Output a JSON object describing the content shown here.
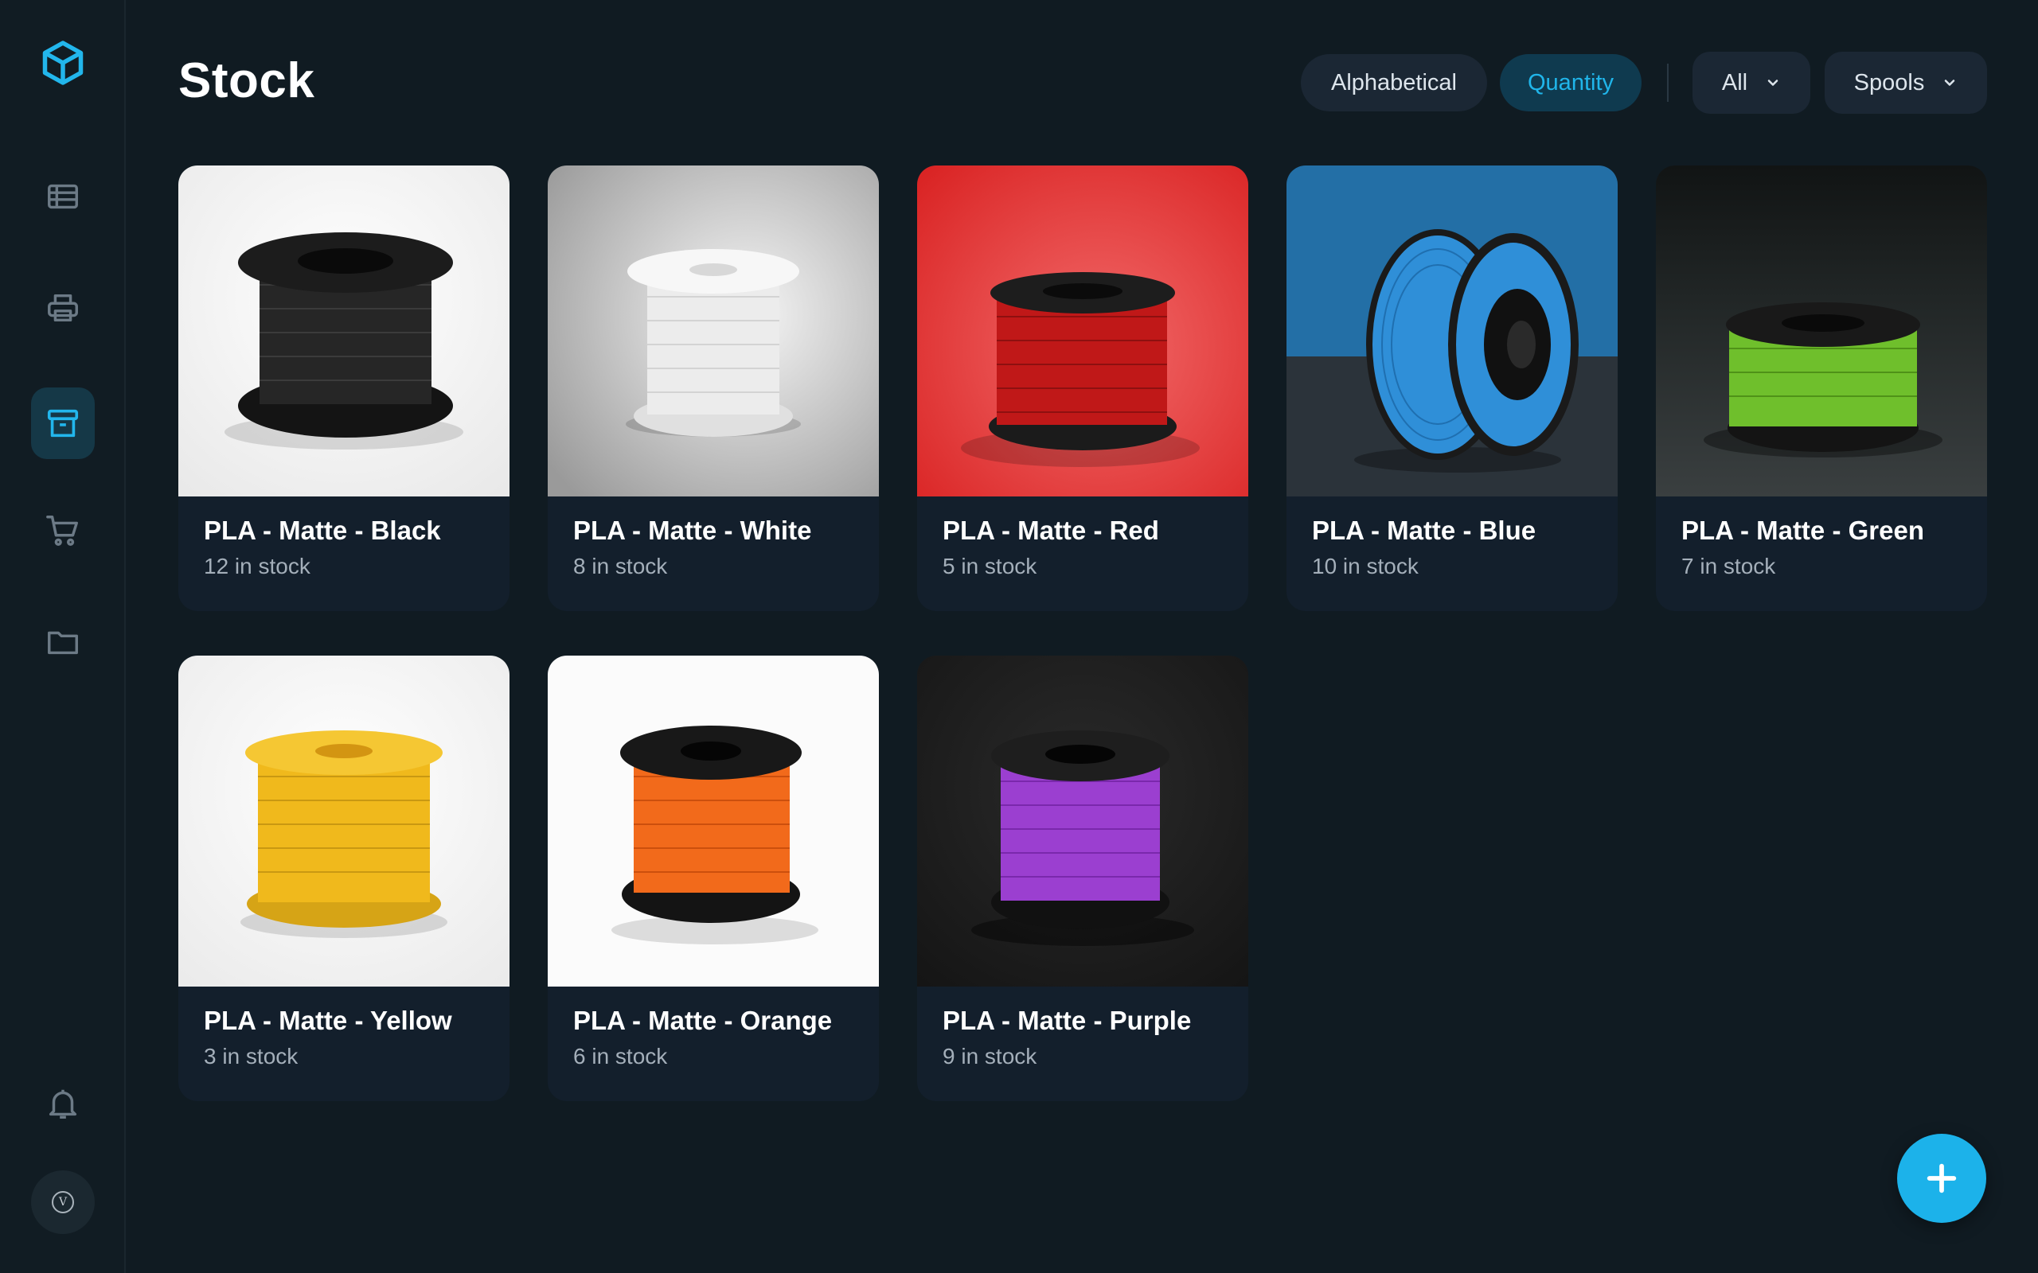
{
  "app": {
    "icons": {
      "logo": "cube-icon",
      "nav": [
        "table-icon",
        "printer-icon",
        "archive-icon",
        "cart-icon",
        "folder-icon"
      ],
      "bell": "bell-icon",
      "add": "plus-icon"
    },
    "accent_color": "#1cb2ea",
    "avatar_initial": "V"
  },
  "header": {
    "title": "Stock",
    "sort_options": [
      "Alphabetical",
      "Quantity"
    ],
    "active_sort": "Quantity",
    "filter_value": "All",
    "type_value": "Spools"
  },
  "items": [
    {
      "name": "PLA - Matte - Black",
      "stock": "12 in stock",
      "color": "#2a2a2a"
    },
    {
      "name": "PLA - Matte - White",
      "stock": "8 in stock",
      "color": "#e6e6e6"
    },
    {
      "name": "PLA - Matte - Red",
      "stock": "5 in stock",
      "color": "#c81b1b"
    },
    {
      "name": "PLA - Matte - Blue",
      "stock": "10 in stock",
      "color": "#2f8fd8"
    },
    {
      "name": "PLA - Matte - Green",
      "stock": "7 in stock",
      "color": "#6fbf2c"
    },
    {
      "name": "PLA - Matte - Yellow",
      "stock": "3 in stock",
      "color": "#f0b91c"
    },
    {
      "name": "PLA - Matte - Orange",
      "stock": "6 in stock",
      "color": "#f26a1b"
    },
    {
      "name": "PLA - Matte - Purple",
      "stock": "9 in stock",
      "color": "#9b3fd0"
    }
  ]
}
